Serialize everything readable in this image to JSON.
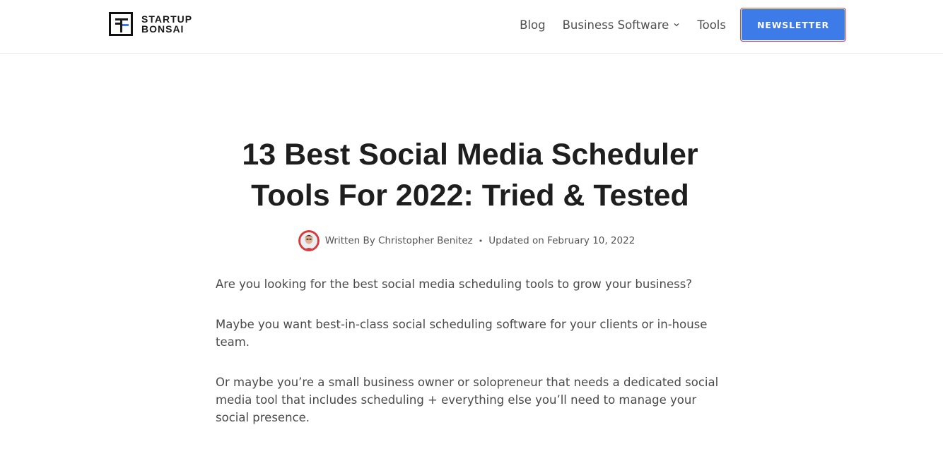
{
  "header": {
    "logo": {
      "line1": "STARTUP",
      "line2": "BONSAI",
      "icon": "bonsai-logo-icon"
    },
    "nav": {
      "blog": "Blog",
      "business_software": "Business Software",
      "tools": "Tools",
      "newsletter": "NEWSLETTER"
    }
  },
  "article": {
    "title_line1": "13 Best Social Media Scheduler",
    "title_line2": "Tools For 2022: Tried & Tested",
    "byline": {
      "written_by": "Written By Christopher Benitez",
      "separator": "•",
      "updated": "Updated on February 10, 2022"
    },
    "paragraphs": [
      "Are you looking for the best social media scheduling tools to grow your business?",
      "Maybe you want best-in-class social scheduling software for your clients or in-house team.",
      "Or maybe you’re a small business owner or solopreneur that needs a dedicated social media tool that includes scheduling + everything else you’ll need to manage your social presence."
    ]
  },
  "colors": {
    "accent": "#3d7be8",
    "title": "#1e1e1e",
    "body": "#4a4a4a"
  }
}
